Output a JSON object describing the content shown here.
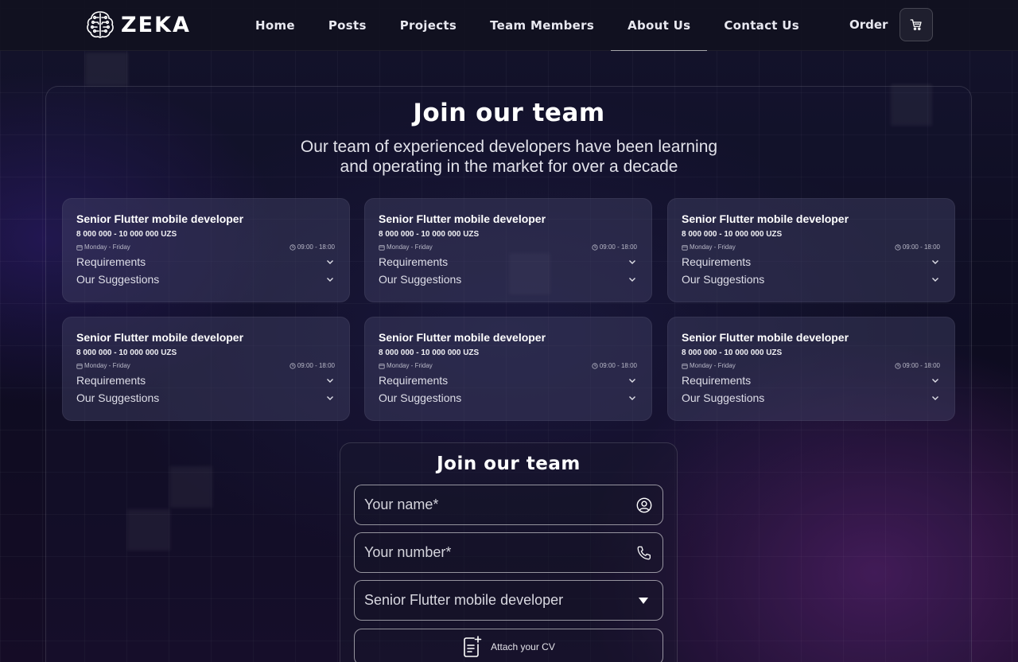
{
  "header": {
    "logo_text": "ZEKA",
    "nav": [
      {
        "label": "Home",
        "active": false
      },
      {
        "label": "Posts",
        "active": false
      },
      {
        "label": "Projects",
        "active": false
      },
      {
        "label": "Team Members",
        "active": false
      },
      {
        "label": "About Us",
        "active": true
      },
      {
        "label": "Contact Us",
        "active": false
      }
    ],
    "order_label": "Order",
    "cart_icon": "cart-icon"
  },
  "main": {
    "title": "Join our team",
    "subtitle_line1": "Our team of experienced developers have been learning",
    "subtitle_line2": "and operating in the market for over a decade",
    "cards": [
      {
        "title": "Senior Flutter mobile developer",
        "salary": "8 000 000 - 10 000 000 UZS",
        "days": "Monday - Friday",
        "hours": "09:00 - 18:00",
        "requirements_label": "Requirements",
        "suggestions_label": "Our Suggestions"
      },
      {
        "title": "Senior Flutter mobile developer",
        "salary": "8 000 000 - 10 000 000 UZS",
        "days": "Monday - Friday",
        "hours": "09:00 - 18:00",
        "requirements_label": "Requirements",
        "suggestions_label": "Our Suggestions"
      },
      {
        "title": "Senior Flutter mobile developer",
        "salary": "8 000 000 - 10 000 000 UZS",
        "days": "Monday - Friday",
        "hours": "09:00 - 18:00",
        "requirements_label": "Requirements",
        "suggestions_label": "Our Suggestions"
      },
      {
        "title": "Senior Flutter mobile developer",
        "salary": "8 000 000 - 10 000 000 UZS",
        "days": "Monday - Friday",
        "hours": "09:00 - 18:00",
        "requirements_label": "Requirements",
        "suggestions_label": "Our Suggestions"
      },
      {
        "title": "Senior Flutter mobile developer",
        "salary": "8 000 000 - 10 000 000 UZS",
        "days": "Monday - Friday",
        "hours": "09:00 - 18:00",
        "requirements_label": "Requirements",
        "suggestions_label": "Our Suggestions"
      },
      {
        "title": "Senior Flutter mobile developer",
        "salary": "8 000 000 - 10 000 000 UZS",
        "days": "Monday - Friday",
        "hours": "09:00 - 18:00",
        "requirements_label": "Requirements",
        "suggestions_label": "Our Suggestions"
      }
    ]
  },
  "form": {
    "title": "Join our team",
    "name_placeholder": "Your name*",
    "number_placeholder": "Your number*",
    "position_selected": "Senior Flutter mobile developer",
    "attach_label": "Attach your CV"
  }
}
